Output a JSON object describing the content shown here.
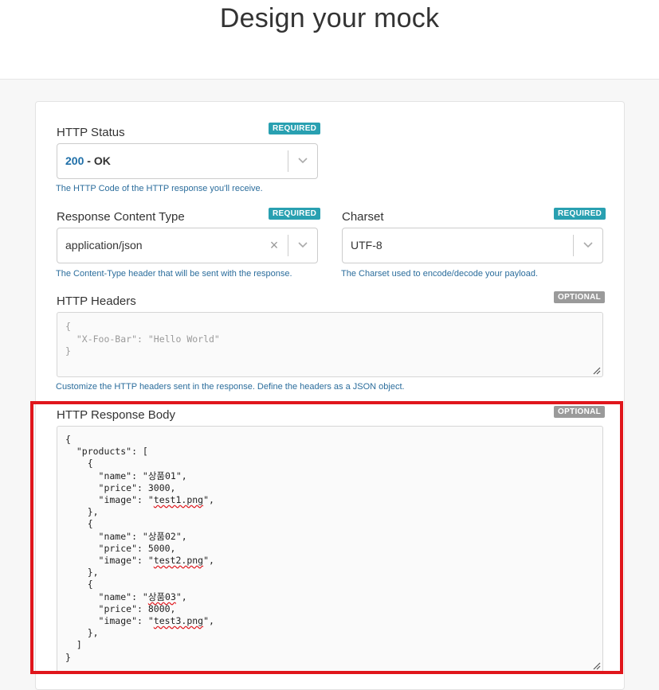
{
  "page": {
    "title": "Design your mock"
  },
  "badges": {
    "required": "REQUIRED",
    "optional": "OPTIONAL"
  },
  "http_status": {
    "label": "HTTP Status",
    "code": "200",
    "separator": " - ",
    "text": "OK",
    "help": "The HTTP Code of the HTTP response you'll receive."
  },
  "content_type": {
    "label": "Response Content Type",
    "value": "application/json",
    "help": "The Content-Type header that will be sent with the response."
  },
  "charset": {
    "label": "Charset",
    "value": "UTF-8",
    "help": "The Charset used to encode/decode your payload."
  },
  "headers": {
    "label": "HTTP Headers",
    "placeholder": "{\n  \"X-Foo-Bar\": \"Hello World\"\n}",
    "help": "Customize the HTTP headers sent in the response. Define the headers as a JSON object."
  },
  "response_body": {
    "label": "HTTP Response Body",
    "lines": [
      "{",
      "  \"products\": [",
      "    {",
      "      \"name\": \"상품01\",",
      "      \"price\": 3000,",
      "      \"image\": \"test1.png\",",
      "    },",
      "    {",
      "      \"name\": \"상품02\",",
      "      \"price\": 5000,",
      "      \"image\": \"test2.png\",",
      "    },",
      "    {",
      "      \"name\": \"상품03\",",
      "      \"price\": 8000,",
      "      \"image\": \"test3.png\",",
      "    },",
      "  ]",
      "}"
    ]
  },
  "icons": {
    "dropdown": "chevron-down-icon",
    "clear": "clear-x-icon",
    "resize": "resize-handle-icon"
  },
  "colors": {
    "required_badge": "#29a0b1",
    "optional_badge": "#9a9a9a",
    "help_text": "#2b6d9c",
    "status_code": "#1f6fa8",
    "highlight_box": "#e0161c"
  }
}
